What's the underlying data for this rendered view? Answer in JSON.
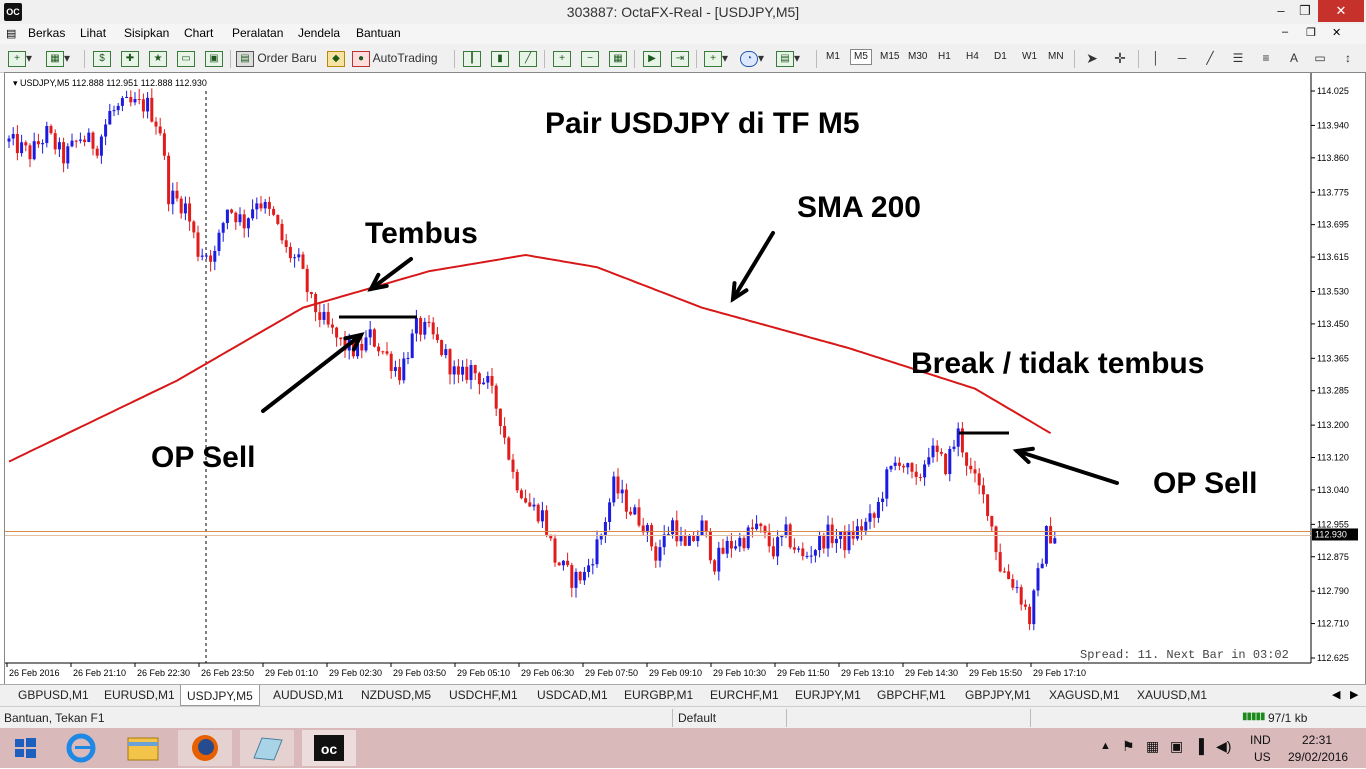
{
  "window": {
    "title": "303887: OctaFX-Real - [USDJPY,M5]",
    "app_icon_label": "OC",
    "buttons": {
      "minimize": "–",
      "restore": "❐",
      "close": "✕"
    }
  },
  "menu": [
    "Berkas",
    "Lihat",
    "Sisipkan",
    "Chart",
    "Peralatan",
    "Jendela",
    "Bantuan"
  ],
  "toolbar": {
    "order_label": "Order Baru",
    "autotrading_label": "AutoTrading",
    "timeframes": [
      "M1",
      "M5",
      "M15",
      "M30",
      "H1",
      "H4",
      "D1",
      "W1",
      "MN"
    ],
    "active_timeframe": "M5"
  },
  "chart": {
    "header": "USDJPY,M5  112.888 112.951 112.888 112.930",
    "spread": "Spread: 11. Next Bar in 03:02",
    "current_price": "112.930",
    "annotations": {
      "title": "Pair USDJPY di TF M5",
      "sma": "SMA 200",
      "tembus": "Tembus",
      "op_sell_left": "OP Sell",
      "break": "Break / tidak tembus",
      "op_sell_right": "OP Sell"
    },
    "colors": {
      "bull": "#1c1ce0",
      "bear": "#e01c1c",
      "sma": "#d81818",
      "price_line": "#d98a4a"
    }
  },
  "chart_data": {
    "type": "candlestick",
    "title": "",
    "y_ticks": [
      "114.025",
      "113.940",
      "113.860",
      "113.775",
      "113.695",
      "113.615",
      "113.530",
      "113.450",
      "113.365",
      "113.285",
      "113.200",
      "113.120",
      "113.040",
      "112.955",
      "112.875",
      "112.790",
      "112.710",
      "112.625"
    ],
    "ylim": [
      112.625,
      114.025
    ],
    "x_ticks": [
      "26 Feb 2016",
      "26 Feb 21:10",
      "26 Feb 22:30",
      "26 Feb 23:50",
      "29 Feb 01:10",
      "29 Feb 02:30",
      "29 Feb 03:50",
      "29 Feb 05:10",
      "29 Feb 06:30",
      "29 Feb 07:50",
      "29 Feb 09:10",
      "29 Feb 10:30",
      "29 Feb 11:50",
      "29 Feb 13:10",
      "29 Feb 14:30",
      "29 Feb 15:50",
      "29 Feb 17:10"
    ],
    "close_path": [
      [
        0,
        113.9
      ],
      [
        5,
        113.87
      ],
      [
        9,
        113.92
      ],
      [
        13,
        113.86
      ],
      [
        17,
        113.91
      ],
      [
        21,
        113.89
      ],
      [
        24,
        113.97
      ],
      [
        28,
        113.99
      ],
      [
        33,
        113.99
      ],
      [
        36,
        113.93
      ],
      [
        38,
        113.77
      ],
      [
        42,
        113.74
      ],
      [
        45,
        113.63
      ],
      [
        49,
        113.62
      ],
      [
        52,
        113.74
      ],
      [
        56,
        113.7
      ],
      [
        59,
        113.76
      ],
      [
        63,
        113.71
      ],
      [
        66,
        113.63
      ],
      [
        69,
        113.6
      ],
      [
        72,
        113.5
      ],
      [
        76,
        113.44
      ],
      [
        79,
        113.4
      ],
      [
        83,
        113.38
      ],
      [
        86,
        113.42
      ],
      [
        90,
        113.37
      ],
      [
        93,
        113.33
      ],
      [
        97,
        113.44
      ],
      [
        100,
        113.43
      ],
      [
        104,
        113.37
      ],
      [
        107,
        113.31
      ],
      [
        110,
        113.34
      ],
      [
        114,
        113.3
      ],
      [
        117,
        113.22
      ],
      [
        120,
        113.08
      ],
      [
        124,
        113.0
      ],
      [
        127,
        112.98
      ],
      [
        130,
        112.87
      ],
      [
        134,
        112.82
      ],
      [
        137,
        112.83
      ],
      [
        141,
        112.93
      ],
      [
        144,
        113.05
      ],
      [
        148,
        112.99
      ],
      [
        151,
        112.96
      ],
      [
        154,
        112.88
      ],
      [
        158,
        112.96
      ],
      [
        161,
        112.89
      ],
      [
        165,
        112.95
      ],
      [
        168,
        112.86
      ],
      [
        171,
        112.9
      ],
      [
        175,
        112.92
      ],
      [
        178,
        112.95
      ],
      [
        182,
        112.89
      ],
      [
        185,
        112.93
      ],
      [
        189,
        112.87
      ],
      [
        192,
        112.9
      ],
      [
        195,
        112.93
      ],
      [
        199,
        112.91
      ],
      [
        202,
        112.94
      ],
      [
        206,
        112.97
      ],
      [
        209,
        113.07
      ],
      [
        212,
        113.12
      ],
      [
        216,
        113.05
      ],
      [
        219,
        113.14
      ],
      [
        223,
        113.1
      ],
      [
        226,
        113.18
      ],
      [
        229,
        113.08
      ],
      [
        233,
        113.0
      ],
      [
        236,
        112.85
      ],
      [
        240,
        112.8
      ],
      [
        243,
        112.72
      ],
      [
        247,
        112.93
      ]
    ],
    "sma_path": [
      [
        0,
        113.11
      ],
      [
        40,
        113.31
      ],
      [
        70,
        113.49
      ],
      [
        100,
        113.58
      ],
      [
        123,
        113.62
      ],
      [
        140,
        113.59
      ],
      [
        165,
        113.49
      ],
      [
        200,
        113.39
      ],
      [
        230,
        113.29
      ],
      [
        248,
        113.18
      ]
    ],
    "current_price": 112.93
  },
  "tabs": [
    "GBPUSD,M1",
    "EURUSD,M1",
    "USDJPY,M5",
    "AUDUSD,M1",
    "NZDUSD,M5",
    "USDCHF,M1",
    "USDCAD,M1",
    "EURGBP,M1",
    "EURCHF,M1",
    "EURJPY,M1",
    "GBPCHF,M1",
    "GBPJPY,M1",
    "XAGUSD,M1",
    "XAUUSD,M1"
  ],
  "active_tab": "USDJPY,M5",
  "status": {
    "help": "Bantuan, Tekan F1",
    "profile": "Default",
    "traffic": "97/1 kb"
  },
  "taskbar": {
    "lang": "IND",
    "layout": "US",
    "time": "22:31",
    "date": "29/02/2016",
    "icons": [
      "windows-start-icon",
      "internet-explorer-icon",
      "file-explorer-icon",
      "firefox-icon",
      "notes-icon",
      "octafx-icon"
    ]
  }
}
